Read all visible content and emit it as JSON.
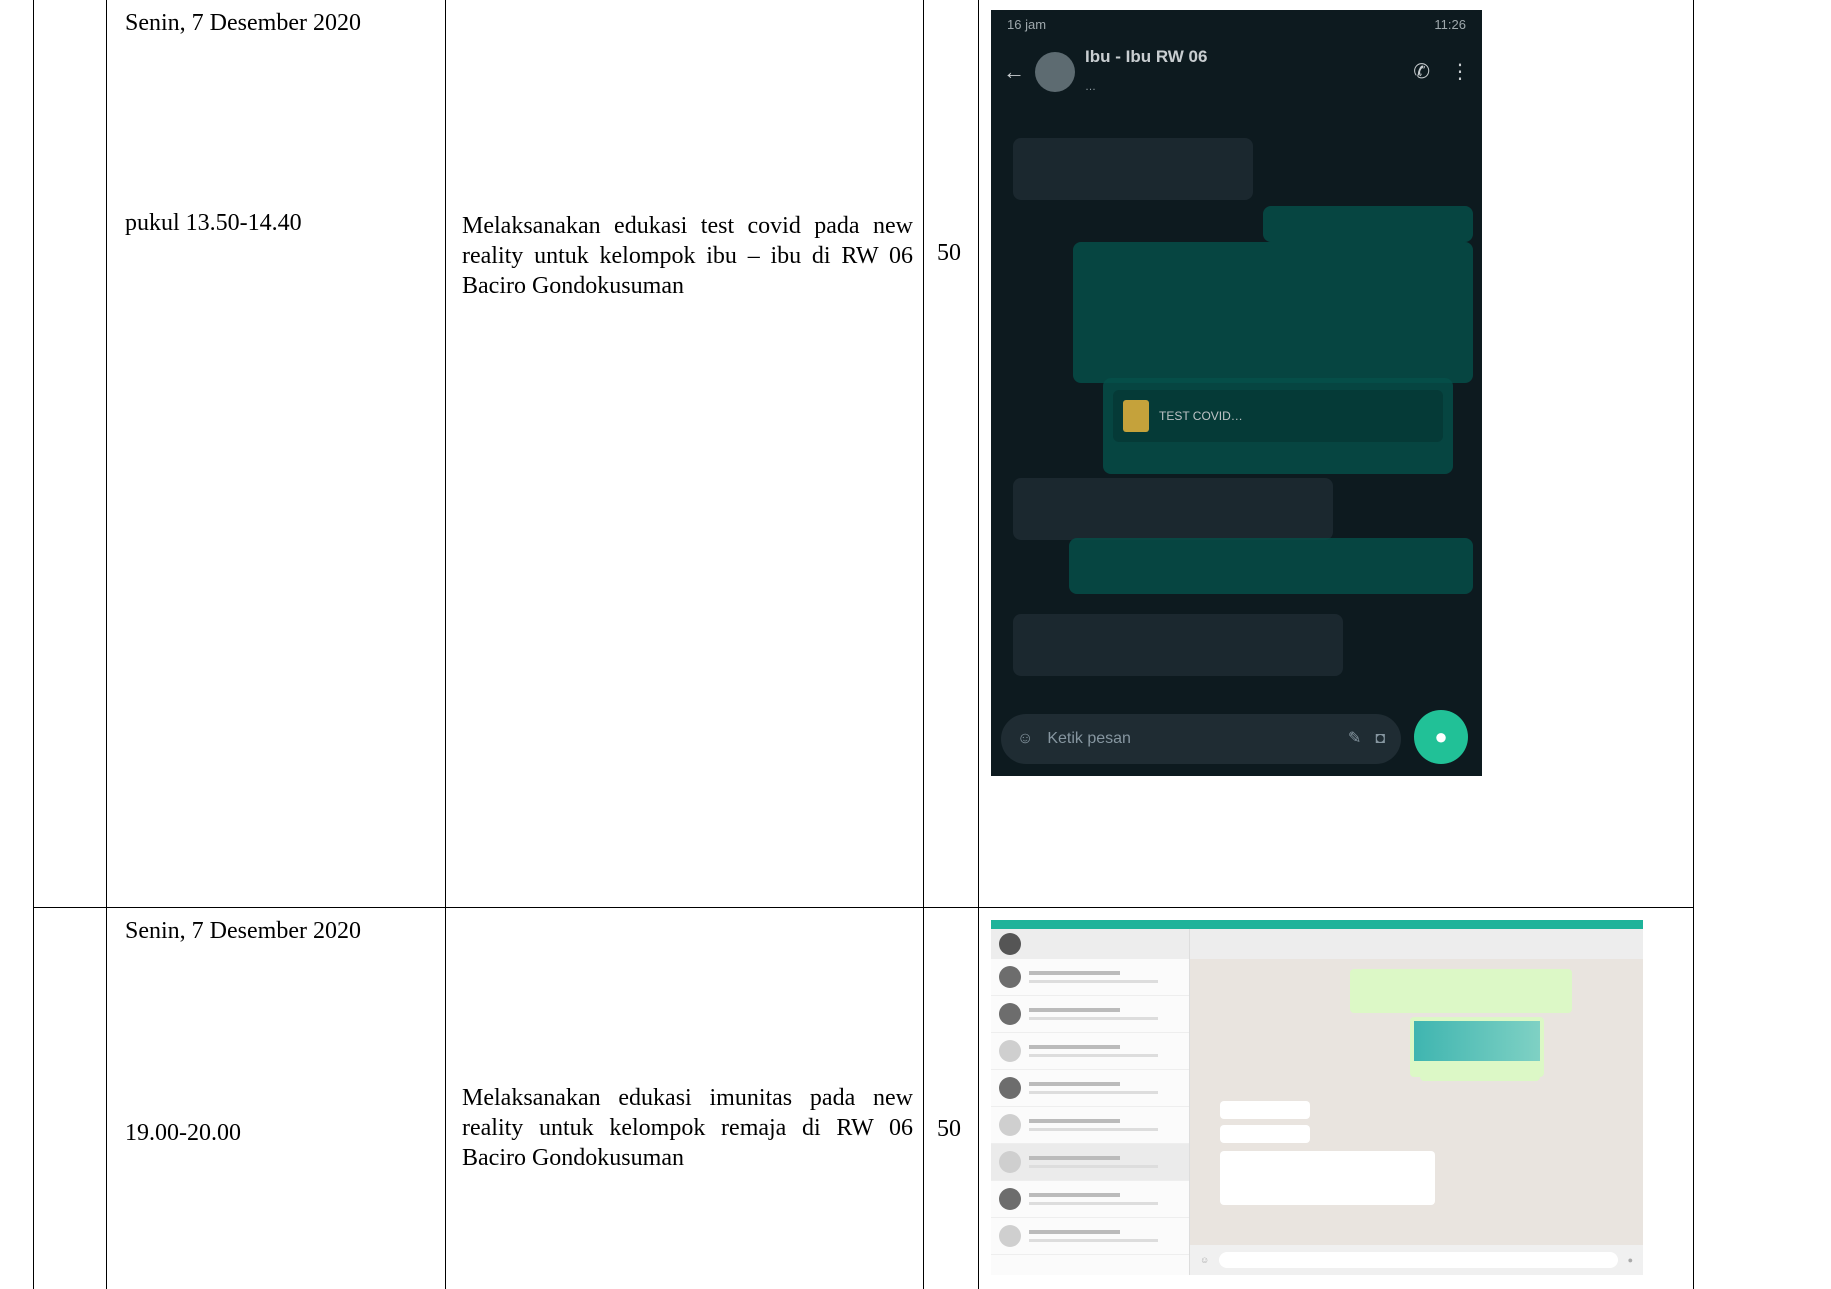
{
  "rows": [
    {
      "date": "Senin, 7 Desember 2020",
      "time": "pukul 13.50-14.40",
      "activity": "Melaksanakan edukasi test covid pada new reality untuk kelompok ibu – ibu di RW 06 Baciro Gondokusuman",
      "count": "50",
      "doc": {
        "status_left": "16 jam",
        "status_right": "11:26",
        "chat_name": "Ibu - Ibu RW 06",
        "chat_sub": "…",
        "attachment_name": "TEST COVID…",
        "input_placeholder": "Ketik pesan"
      }
    },
    {
      "date": "Senin, 7 Desember 2020",
      "time": "19.00-20.00",
      "activity": "Melaksanakan edukasi imunitas pada new reality untuk kelompok remaja di RW 06 Baciro Gondokusuman",
      "count": "50"
    }
  ]
}
